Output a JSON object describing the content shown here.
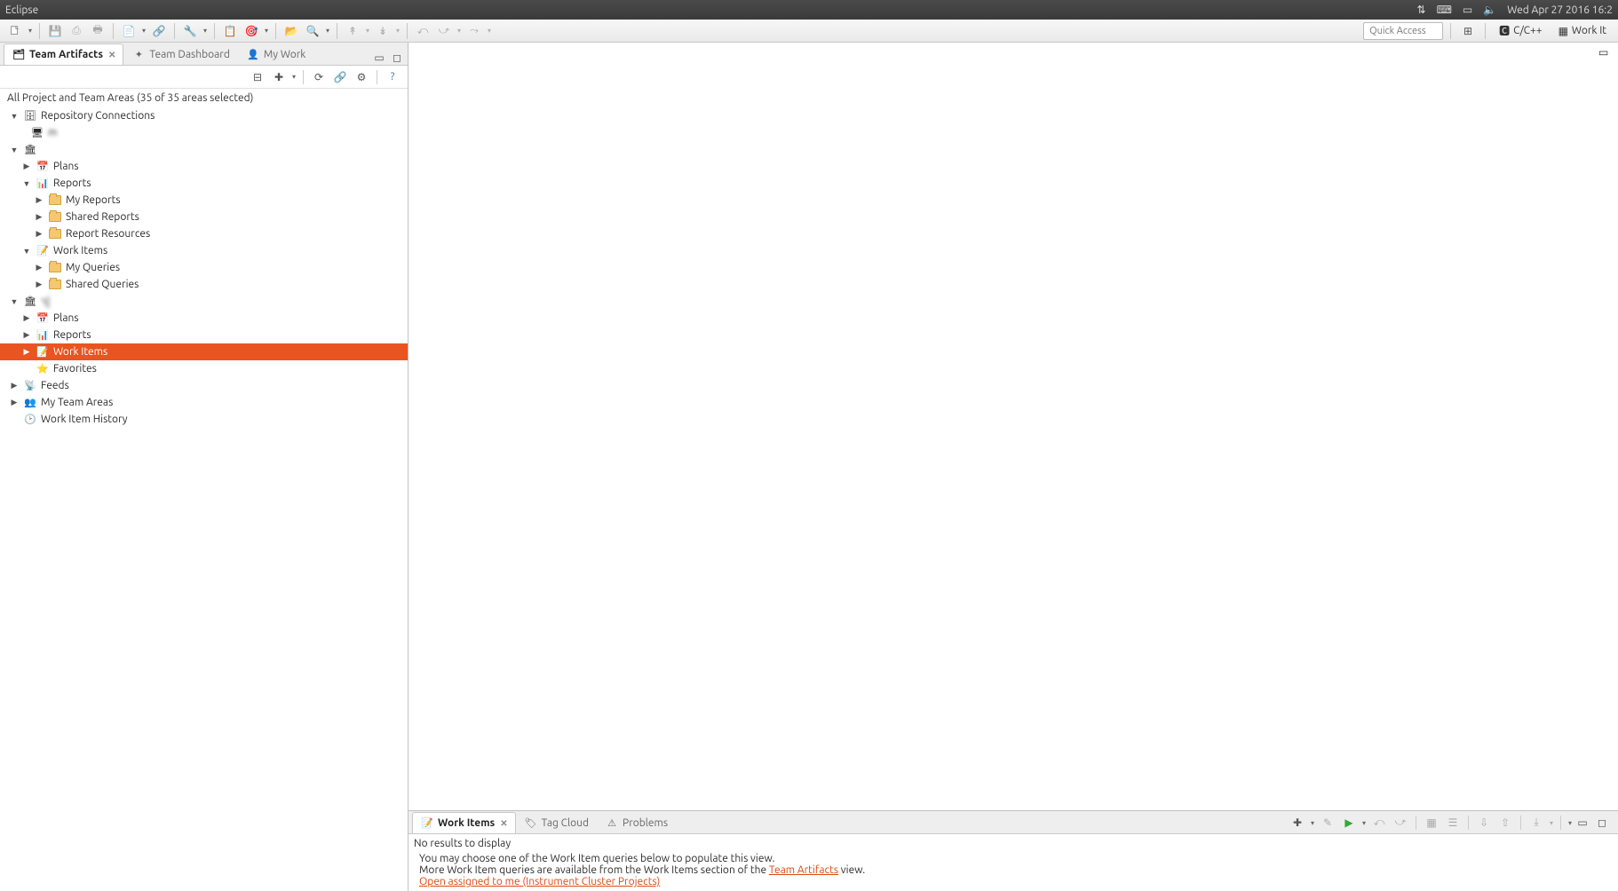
{
  "os": {
    "title": "Eclipse",
    "clock": "Wed Apr 27 2016 16:2"
  },
  "quick_access_placeholder": "Quick Access",
  "perspectives": {
    "cpp": "C/C++",
    "workitems": "Work It"
  },
  "left": {
    "tabs": {
      "artifacts": "Team Artifacts",
      "dashboard": "Team Dashboard",
      "mywork": "My Work"
    },
    "filter": "All Project and Team Areas (35 of 35 areas selected)",
    "tree": {
      "repo_connections": "Repository Connections",
      "repo_child_obscured": "m",
      "proj1_obscured": " ",
      "plans1": "Plans",
      "reports1": "Reports",
      "my_reports": "My Reports",
      "shared_reports": "Shared Reports",
      "report_resources": "Report Resources",
      "work_items1": "Work Items",
      "my_queries": "My Queries",
      "shared_queries": "Shared Queries",
      "proj2_obscured": "ר]",
      "plans2": "Plans",
      "reports2": "Reports",
      "work_items2": "Work Items",
      "favorites": "Favorites",
      "feeds": "Feeds",
      "my_team_areas": "My Team Areas",
      "work_item_history": "Work Item History"
    }
  },
  "bottom": {
    "tabs": {
      "workitems": "Work Items",
      "tagcloud": "Tag Cloud",
      "problems": "Problems"
    },
    "no_results": "No results to display",
    "hint1": "You may choose one of the Work Item queries below to populate this view.",
    "hint2a": "More Work Item queries are available from the Work Items section of the ",
    "hint2_link": "Team Artifacts",
    "hint2b": " view.",
    "query_link": "Open assigned to me (Instrument Cluster Projects)"
  }
}
